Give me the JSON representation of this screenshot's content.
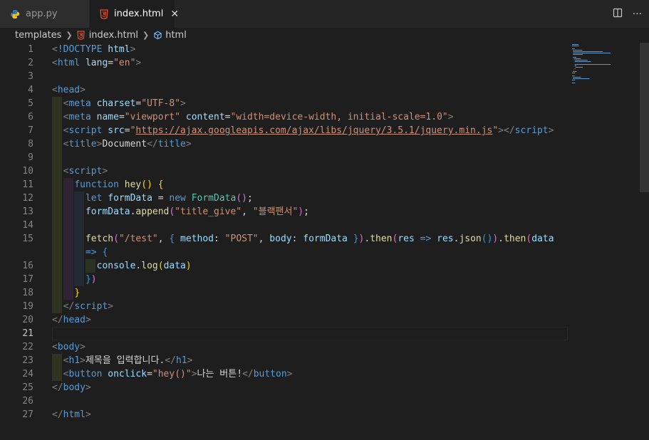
{
  "tabs": [
    {
      "label": "app.py",
      "icon": "python-icon",
      "active": false
    },
    {
      "label": "index.html",
      "icon": "html5-icon",
      "active": true,
      "close": "✕"
    }
  ],
  "actions": {
    "split": "split-editor-icon",
    "more": "···"
  },
  "breadcrumb": {
    "folder": "templates",
    "file": "index.html",
    "element": "html"
  },
  "colors": {
    "accent": "#569cd6",
    "string": "#ce9178",
    "background": "#1e1e1e"
  },
  "active_line": 21,
  "lines": [
    {
      "num": "1",
      "html": "<span class='p'>&lt;</span><span class='t'>!DOCTYPE</span> <span class='a'>html</span><span class='p'>&gt;</span>"
    },
    {
      "num": "2",
      "html": "<span class='p'>&lt;</span><span class='t'>html</span> <span class='a'>lang</span><span class='tx'>=</span><span class='s'>\"en\"</span><span class='p'>&gt;</span>"
    },
    {
      "num": "3",
      "html": ""
    },
    {
      "num": "4",
      "html": "<span class='p'>&lt;</span><span class='t'>head</span><span class='p'>&gt;</span>"
    },
    {
      "num": "5",
      "html": "  <span class='p'>&lt;</span><span class='t'>meta</span> <span class='a'>charset</span><span class='tx'>=</span><span class='s'>\"UTF-8\"</span><span class='p'>&gt;</span>"
    },
    {
      "num": "6",
      "html": "  <span class='p'>&lt;</span><span class='t'>meta</span> <span class='a'>name</span><span class='tx'>=</span><span class='s'>\"viewport\"</span> <span class='a'>content</span><span class='tx'>=</span><span class='s'>\"width=device-width, initial-scale=1.0\"</span><span class='p'>&gt;</span>"
    },
    {
      "num": "7",
      "html": "  <span class='p'>&lt;</span><span class='t'>script</span> <span class='a'>src</span><span class='tx'>=</span><span class='s'>\"<span class='u'>https://ajax.googleapis.com/ajax/libs/jquery/3.5.1/jquery.min.js</span>\"</span><span class='p'>&gt;&lt;/</span><span class='t'>script</span><span class='p'>&gt;</span>"
    },
    {
      "num": "8",
      "html": "  <span class='p'>&lt;</span><span class='t'>title</span><span class='p'>&gt;</span><span class='tx'>Document</span><span class='p'>&lt;/</span><span class='t'>title</span><span class='p'>&gt;</span>"
    },
    {
      "num": "9",
      "html": ""
    },
    {
      "num": "10",
      "html": "  <span class='p'>&lt;</span><span class='t'>script</span><span class='p'>&gt;</span>"
    },
    {
      "num": "11",
      "html": "    <span class='k'>function</span> <span class='f'>hey</span><span class='y'>()</span> <span class='y'>{</span>"
    },
    {
      "num": "12",
      "html": "      <span class='k'>let</span> <span class='v'>formData</span> <span class='tx'>=</span> <span class='k'>new</span> <span class='c'>FormData</span><span class='m'>()</span><span class='tx'>;</span>"
    },
    {
      "num": "13",
      "html": "      <span class='v'>formData</span><span class='tx'>.</span><span class='f'>append</span><span class='m'>(</span><span class='s'>\"title_give\"</span><span class='tx'>, </span><span class='s'>\"블랙팬서\"</span><span class='m'>)</span><span class='tx'>;</span>"
    },
    {
      "num": "14",
      "html": ""
    },
    {
      "num": "15",
      "html": "      <span class='f'>fetch</span><span class='m'>(</span><span class='s'>\"/test\"</span><span class='tx'>, </span><span class='b'>{</span> <span class='v'>method</span><span class='tx'>: </span><span class='s'>\"POST\"</span><span class='tx'>, </span><span class='v'>body</span><span class='tx'>: </span><span class='v'>formData</span> <span class='b'>}</span><span class='m'>)</span><span class='tx'>.</span><span class='f'>then</span><span class='m'>(</span><span class='v'>res</span> <span class='k'>=&gt;</span> <span class='v'>res</span><span class='tx'>.</span><span class='f'>json</span><span class='b'>()</span><span class='m'>)</span><span class='tx'>.</span><span class='f'>then</span><span class='m'>(</span><span class='v'>data</span>"
    },
    {
      "num": "",
      "html": "      <span class='k'>=&gt;</span> <span class='b'>{</span>"
    },
    {
      "num": "16",
      "html": "        <span class='v'>console</span><span class='tx'>.</span><span class='f'>log</span><span class='y'>(</span><span class='v'>data</span><span class='y'>)</span>"
    },
    {
      "num": "17",
      "html": "      <span class='b'>}</span><span class='m'>)</span>"
    },
    {
      "num": "18",
      "html": "    <span class='y'>}</span>"
    },
    {
      "num": "19",
      "html": "  <span class='p'>&lt;/</span><span class='t'>script</span><span class='p'>&gt;</span>"
    },
    {
      "num": "20",
      "html": "<span class='p'>&lt;/</span><span class='t'>head</span><span class='p'>&gt;</span>"
    },
    {
      "num": "21",
      "html": ""
    },
    {
      "num": "22",
      "html": "<span class='p'>&lt;</span><span class='t'>body</span><span class='p'>&gt;</span>"
    },
    {
      "num": "23",
      "html": "  <span class='p'>&lt;</span><span class='t'>h1</span><span class='p'>&gt;</span><span class='tx'>제목을 입력합니다.</span><span class='p'>&lt;/</span><span class='t'>h1</span><span class='p'>&gt;</span>"
    },
    {
      "num": "24",
      "html": "  <span class='p'>&lt;</span><span class='t'>button</span> <span class='a'>onclick</span><span class='tx'>=</span><span class='s'>\"hey()\"</span><span class='p'>&gt;</span><span class='tx'>나는 버튼!</span><span class='p'>&lt;/</span><span class='t'>button</span><span class='p'>&gt;</span>"
    },
    {
      "num": "25",
      "html": "<span class='p'>&lt;/</span><span class='t'>body</span><span class='p'>&gt;</span>"
    },
    {
      "num": "26",
      "html": ""
    },
    {
      "num": "27",
      "html": "<span class='p'>&lt;/</span><span class='t'>html</span><span class='p'>&gt;</span>"
    }
  ]
}
